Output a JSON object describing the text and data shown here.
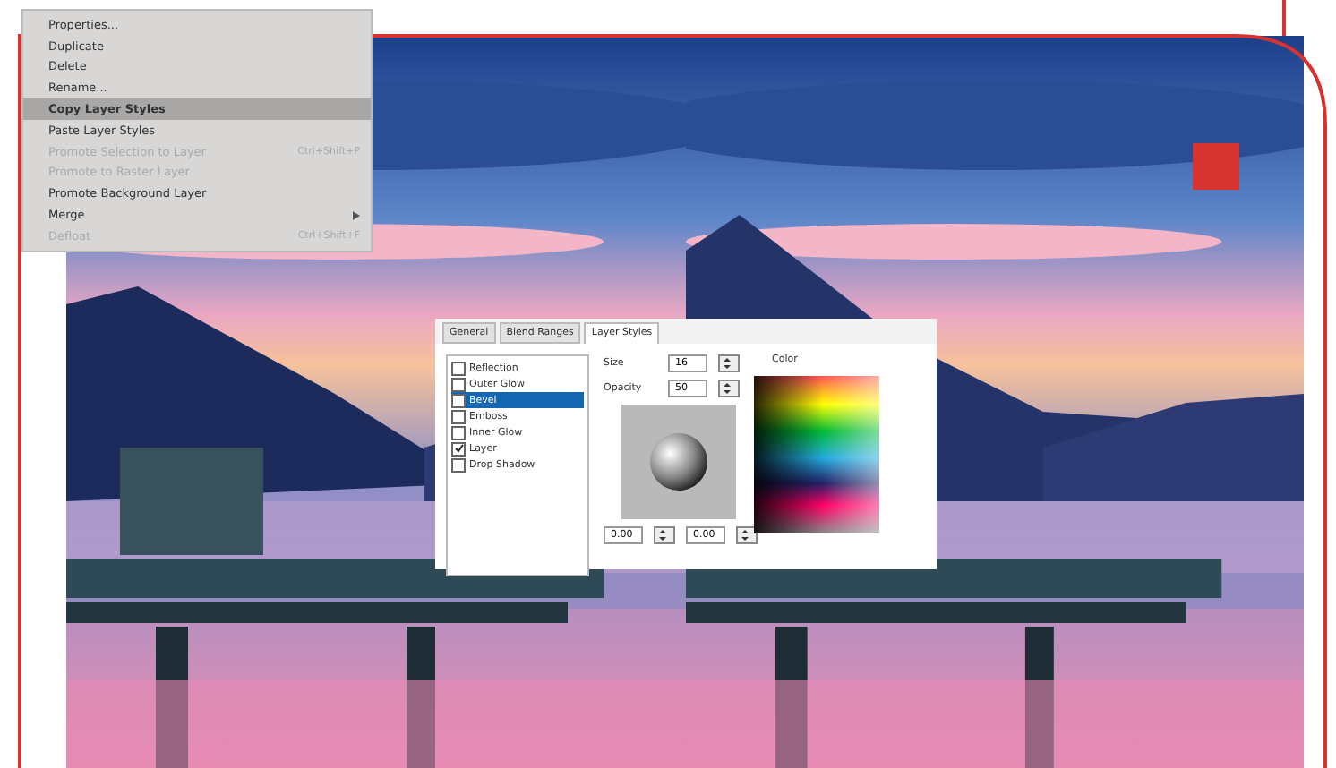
{
  "context_menu": {
    "items": [
      {
        "label": "Properties...",
        "kind": "item",
        "disabled": false,
        "selected": false
      },
      {
        "label": "Duplicate",
        "kind": "item",
        "disabled": false,
        "selected": false
      },
      {
        "label": "Delete",
        "kind": "item",
        "disabled": false,
        "selected": false
      },
      {
        "label": "Rename...",
        "kind": "item",
        "disabled": false,
        "selected": false
      },
      {
        "label": "Copy Layer Styles",
        "kind": "item",
        "disabled": false,
        "selected": true
      },
      {
        "label": "Paste Layer Styles",
        "kind": "item",
        "disabled": false,
        "selected": false
      },
      {
        "label": "Promote Selection to Layer",
        "kind": "item",
        "disabled": true,
        "selected": false,
        "shortcut": "Ctrl+Shift+P"
      },
      {
        "label": "Promote to Raster Layer",
        "kind": "item",
        "disabled": true,
        "selected": false
      },
      {
        "label": "Promote Background Layer",
        "kind": "item",
        "disabled": false,
        "selected": false
      },
      {
        "label": "Merge",
        "kind": "submenu",
        "disabled": false,
        "selected": false
      },
      {
        "label": "Defloat",
        "kind": "item",
        "disabled": true,
        "selected": false,
        "shortcut": "Ctrl+Shift+F"
      }
    ]
  },
  "dialog": {
    "tabs": [
      {
        "label": "General",
        "selected": false
      },
      {
        "label": "Blend Ranges",
        "selected": false
      },
      {
        "label": "Layer Styles",
        "selected": true
      }
    ],
    "effects": [
      {
        "label": "Reflection",
        "checked": false,
        "selected": false
      },
      {
        "label": "Outer Glow",
        "checked": false,
        "selected": false
      },
      {
        "label": "Bevel",
        "checked": false,
        "selected": true
      },
      {
        "label": "Emboss",
        "checked": false,
        "selected": false
      },
      {
        "label": "Inner Glow",
        "checked": false,
        "selected": false
      },
      {
        "label": "Layer",
        "checked": true,
        "selected": false
      },
      {
        "label": "Drop Shadow",
        "checked": false,
        "selected": false
      }
    ],
    "size": {
      "label": "Size",
      "value": "16"
    },
    "opacity": {
      "label": "Opacity",
      "value": "50"
    },
    "color_label": "Color",
    "angle_fields": [
      "0.00",
      "0.00"
    ]
  }
}
